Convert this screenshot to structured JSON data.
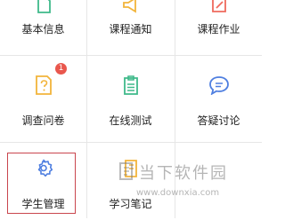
{
  "grid": {
    "row1": [
      {
        "label": "基本信息",
        "icon": "info-icon",
        "color": "#3fb98a"
      },
      {
        "label": "课程通知",
        "icon": "megaphone-icon",
        "color": "#f2b43b"
      },
      {
        "label": "课程作业",
        "icon": "edit-icon",
        "color": "#ef6a5d"
      }
    ],
    "row2": [
      {
        "label": "调查问卷",
        "icon": "survey-icon",
        "color": "#f2b43b",
        "badge": "1"
      },
      {
        "label": "在线测试",
        "icon": "test-clipboard-icon",
        "color": "#3fb98a"
      },
      {
        "label": "答疑讨论",
        "icon": "chat-bubble-icon",
        "color": "#4f7fe0"
      }
    ],
    "row3": [
      {
        "label": "学生管理",
        "icon": "gear-icon",
        "color": "#4f7fe0",
        "selected": true
      },
      {
        "label": "学习笔记",
        "icon": "notebook-icon",
        "color": "#f2b43b"
      }
    ]
  },
  "watermark": {
    "title": "当下软件园",
    "url": "www.downxia.com"
  },
  "colors": {
    "divider": "#e6e6e6",
    "selection_border": "#c9464e",
    "badge": "#e9574d"
  }
}
